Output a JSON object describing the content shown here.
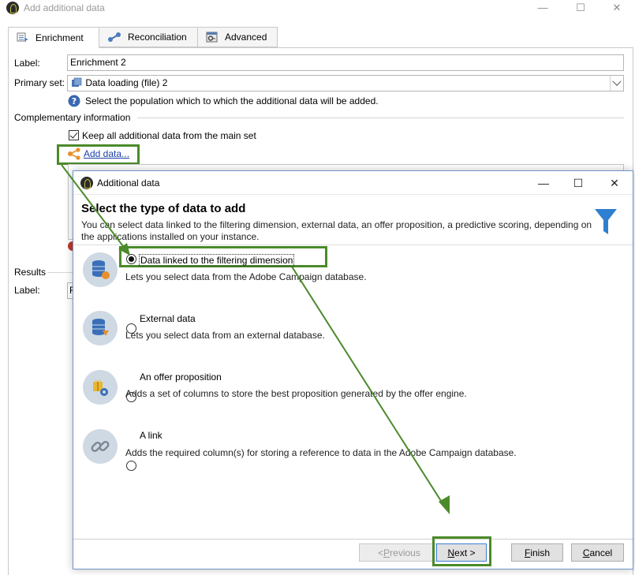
{
  "outer_window": {
    "title": "Add additional data",
    "controls": {
      "minimize": "—",
      "maximize": "☐",
      "close": "✕"
    }
  },
  "tabs": [
    {
      "label": "Enrichment",
      "icon": "enrichment-icon"
    },
    {
      "label": "Reconciliation",
      "icon": "reconciliation-icon"
    },
    {
      "label": "Advanced",
      "icon": "advanced-icon"
    }
  ],
  "form": {
    "label_caption": "Label:",
    "label_value": "Enrichment 2",
    "primary_set_caption": "Primary set:",
    "primary_set_value": "Data loading (file) 2",
    "help_text": "Select the population which to which the additional data will be added.",
    "complementary_heading": "Complementary information",
    "keep_all_label": "Keep all additional data from the main set",
    "keep_all_checked": true,
    "add_data_link": "Add data...",
    "results_heading": "Results",
    "results_label_caption": "Label:",
    "results_label_value": "F"
  },
  "dialog": {
    "title": "Additional data",
    "controls": {
      "minimize": "—",
      "maximize": "☐",
      "close": "✕"
    },
    "heading": "Select the type of data to add",
    "description": "You can select data linked to the filtering dimension, external data, an offer proposition, a predictive scoring, depending on the applications installed on your instance.",
    "options": [
      {
        "label": "Data linked to the filtering dimension",
        "description": "Lets you select data from the Adobe Campaign database.",
        "selected": true,
        "icon": "database-orange-icon"
      },
      {
        "label": "External data",
        "description": "Lets you select data from an external database.",
        "selected": false,
        "icon": "external-database-icon"
      },
      {
        "label": "An offer proposition",
        "description": "Adds a set of columns to store the best proposition generated by the offer engine.",
        "selected": false,
        "icon": "offer-gear-icon"
      },
      {
        "label": "A link",
        "description": "Adds the required column(s) for storing a reference to data in the Adobe Campaign database.",
        "selected": false,
        "icon": "link-icon"
      }
    ],
    "buttons": {
      "previous": {
        "prefix": "< ",
        "mnemonic": "P",
        "rest": "revious"
      },
      "next": {
        "mnemonic": "N",
        "rest": "ext >"
      },
      "finish": {
        "mnemonic": "F",
        "rest": "inish"
      },
      "cancel": {
        "mnemonic": "C",
        "rest": "ancel"
      }
    }
  },
  "colors": {
    "callout_green": "#4b8a2a",
    "dialog_border": "#6f95c8",
    "funnel_blue": "#2f7fd0",
    "icon_circle": "#cfd9e3",
    "link_orange": "#e8902a"
  }
}
